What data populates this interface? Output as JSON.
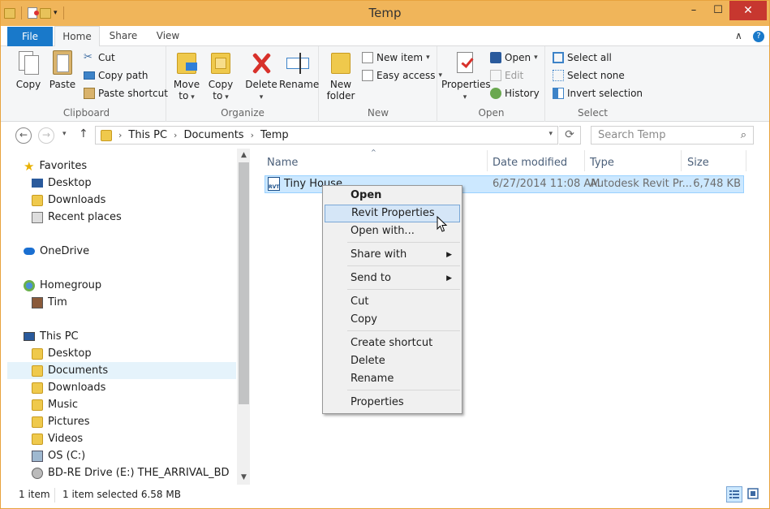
{
  "window": {
    "title": "Temp",
    "minimize": "–",
    "maximize": "☐",
    "close": "✕"
  },
  "tabs": {
    "file": "File",
    "home": "Home",
    "share": "Share",
    "view": "View",
    "collapse": "∧",
    "help": "?"
  },
  "ribbon": {
    "clipboard": {
      "label": "Clipboard",
      "copy": "Copy",
      "paste": "Paste",
      "cut": "Cut",
      "copy_path": "Copy path",
      "paste_shortcut": "Paste shortcut"
    },
    "organize": {
      "label": "Organize",
      "move_to": "Move",
      "move_to2": "to",
      "copy_to": "Copy",
      "copy_to2": "to",
      "delete": "Delete",
      "rename": "Rename"
    },
    "new": {
      "label": "New",
      "new_folder": "New",
      "new_folder2": "folder",
      "new_item": "New item",
      "easy_access": "Easy access"
    },
    "open": {
      "label": "Open",
      "properties": "Properties",
      "open": "Open",
      "edit": "Edit",
      "history": "History"
    },
    "select": {
      "label": "Select",
      "select_all": "Select all",
      "select_none": "Select none",
      "invert": "Invert selection"
    }
  },
  "address": {
    "back": "←",
    "forward": "→",
    "up": "↑",
    "crumbs": [
      "This PC",
      "Documents",
      "Temp"
    ],
    "refresh": "⟳",
    "search_placeholder": "Search Temp",
    "search_icon": "⌕"
  },
  "nav": {
    "favorites": "Favorites",
    "desktop": "Desktop",
    "downloads": "Downloads",
    "recent": "Recent places",
    "onedrive": "OneDrive",
    "homegroup": "Homegroup",
    "tim": "Tim",
    "thispc": "This PC",
    "pc_desktop": "Desktop",
    "pc_documents": "Documents",
    "pc_downloads": "Downloads",
    "pc_music": "Music",
    "pc_pictures": "Pictures",
    "pc_videos": "Videos",
    "os": "OS (C:)",
    "bd": "BD-RE Drive (E:) THE_ARRIVAL_BD"
  },
  "columns": {
    "name": "Name",
    "date": "Date modified",
    "type": "Type",
    "size": "Size"
  },
  "files": [
    {
      "name": "Tiny House",
      "date": "6/27/2014 11:08 AM",
      "type": "Autodesk Revit Pr...",
      "size": "6,748 KB",
      "icon_text": "RVT"
    }
  ],
  "context_menu": {
    "open": "Open",
    "revit_properties": "Revit Properties",
    "open_with": "Open with...",
    "share_with": "Share with",
    "send_to": "Send to",
    "cut": "Cut",
    "copy": "Copy",
    "create_shortcut": "Create shortcut",
    "delete": "Delete",
    "rename": "Rename",
    "properties": "Properties"
  },
  "status": {
    "count": "1 item",
    "selected": "1 item selected  6.58 MB"
  },
  "colors": {
    "titlebar": "#f0b55a",
    "file_tab": "#1979ca",
    "close": "#c7372f",
    "selection": "#cce8ff"
  }
}
